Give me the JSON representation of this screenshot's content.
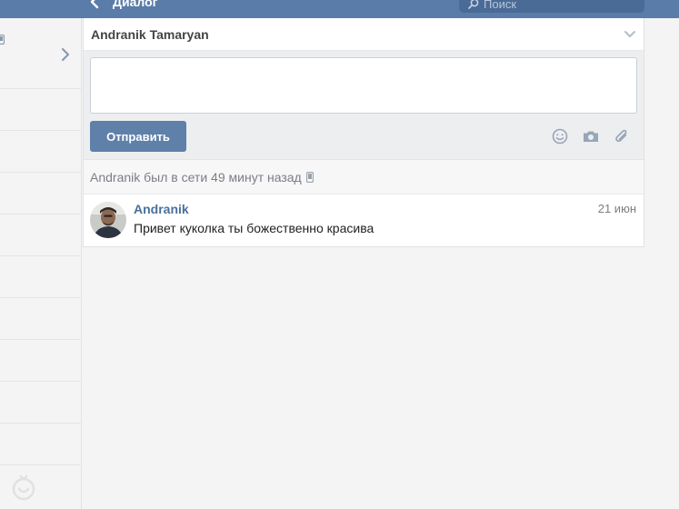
{
  "topbar": {
    "back_label": "Диалог",
    "search_placeholder": "Поиск"
  },
  "dialog": {
    "header_name": "Andranik Tamaryan",
    "compose": {
      "input_value": "",
      "send_label": "Отправить",
      "icons": [
        "smile-icon",
        "camera-icon",
        "paperclip-icon"
      ]
    },
    "status_text": "Andranik был в сети 49 минут назад",
    "messages": [
      {
        "author": "Andranik",
        "text": "Привет куколка ты божественно красива",
        "date": "21 июн"
      }
    ]
  },
  "colors": {
    "topbar": "#5a7ca8",
    "search_bg": "#4a6b96",
    "send_button": "#5f80a8",
    "author_link": "#4a6f9c"
  }
}
